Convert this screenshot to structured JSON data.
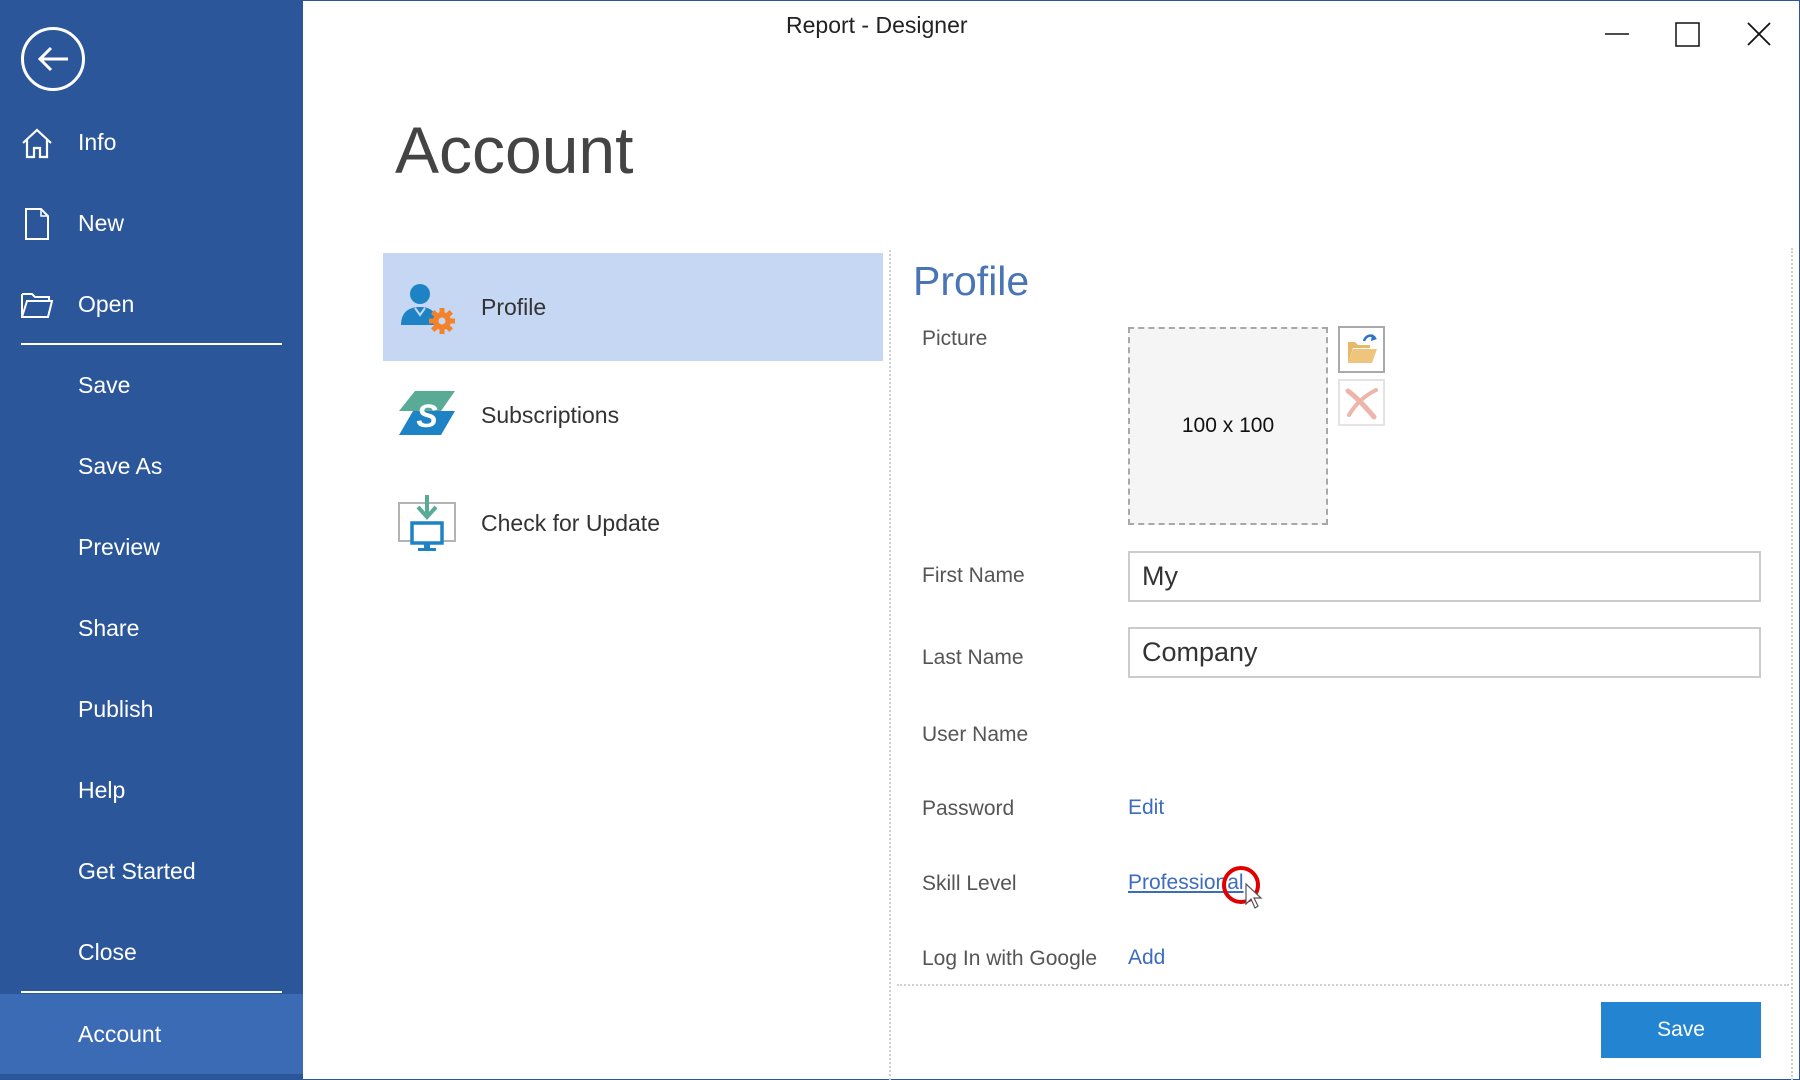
{
  "window": {
    "title": "Report - Designer",
    "controls": [
      "minimize",
      "maximize",
      "close"
    ]
  },
  "sidebar": {
    "back_icon": "arrow-left-circle-icon",
    "items": [
      {
        "label": "Info",
        "icon": "home-icon"
      },
      {
        "label": "New",
        "icon": "document-icon"
      },
      {
        "label": "Open",
        "icon": "folder-open-icon"
      },
      {
        "label": "Save"
      },
      {
        "label": "Save As"
      },
      {
        "label": "Preview"
      },
      {
        "label": "Share"
      },
      {
        "label": "Publish"
      },
      {
        "label": "Help"
      },
      {
        "label": "Get Started"
      },
      {
        "label": "Close"
      },
      {
        "label": "Account",
        "selected": true
      }
    ]
  },
  "page": {
    "title": "Account"
  },
  "options": [
    {
      "label": "Profile",
      "icon": "profile-settings-icon",
      "selected": true
    },
    {
      "label": "Subscriptions",
      "icon": "subscriptions-icon"
    },
    {
      "label": "Check for Update",
      "icon": "download-update-icon"
    }
  ],
  "profile": {
    "section_title": "Profile",
    "picture": {
      "label": "Picture",
      "placeholder_text": "100 x 100",
      "load_icon": "folder-load-icon",
      "clear_icon": "delete-x-icon"
    },
    "first_name": {
      "label": "First Name",
      "value": "My"
    },
    "last_name": {
      "label": "Last Name",
      "value": "Company"
    },
    "user_name": {
      "label": "User Name",
      "value": ""
    },
    "password": {
      "label": "Password",
      "action": "Edit"
    },
    "skill_level": {
      "label": "Skill Level",
      "value": "Professional"
    },
    "google_login": {
      "label": "Log In with Google",
      "action": "Add"
    },
    "save_label": "Save"
  },
  "colors": {
    "sidebar_bg": "#2b579a",
    "sidebar_selected": "#3c6bb5",
    "option_selected": "#c5d7f2",
    "heading_blue": "#4a75b5",
    "link_blue": "#3d6cbf",
    "save_button": "#2384d2"
  }
}
